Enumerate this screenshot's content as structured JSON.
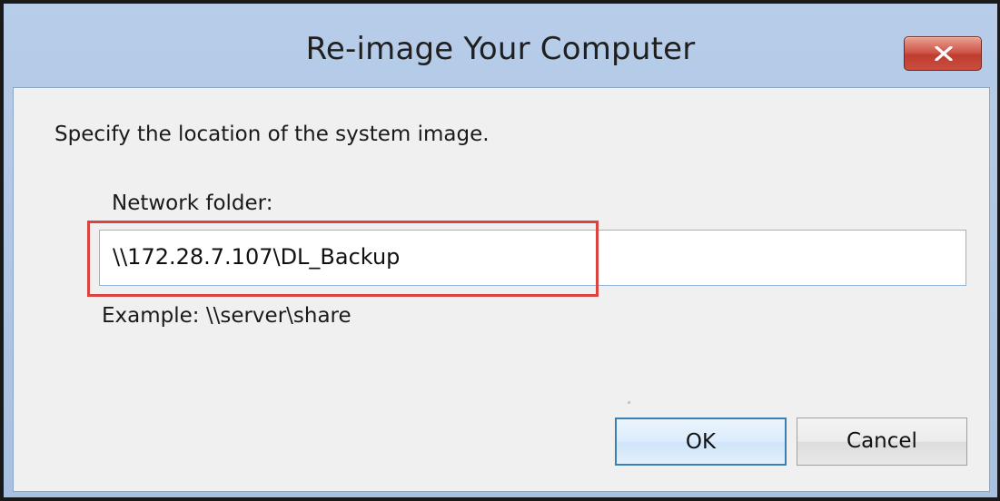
{
  "window": {
    "title": "Re-image Your Computer",
    "close_icon": "close-icon"
  },
  "dialog": {
    "instruction": "Specify the location of the system image.",
    "network_folder": {
      "label": "Network folder:",
      "value": "\\\\172.28.7.107\\DL_Backup"
    },
    "example": "Example: \\\\server\\share",
    "buttons": {
      "ok_label": "OK",
      "cancel_label": "Cancel"
    }
  },
  "colors": {
    "highlight": "#d9443e",
    "close_button": "#c94d3e",
    "frame": "#a9c3e3"
  }
}
